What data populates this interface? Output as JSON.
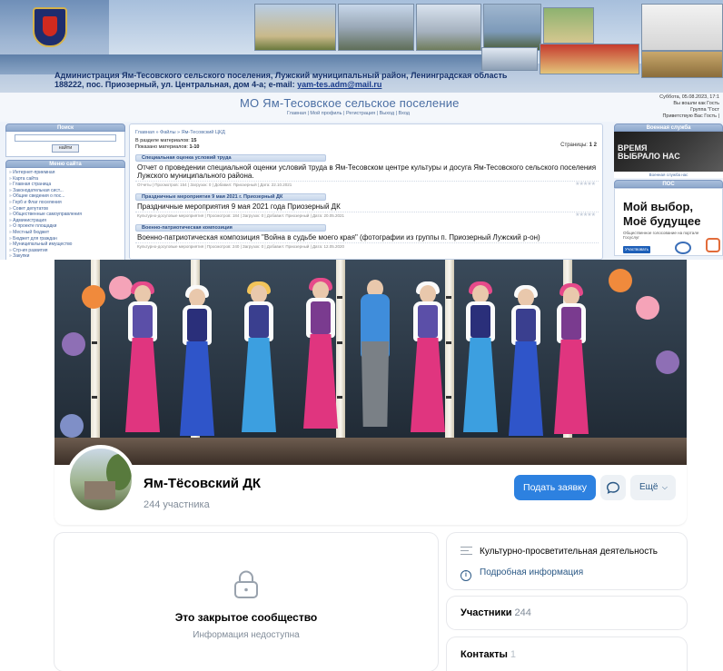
{
  "site": {
    "address_line1": "Администрация Ям-Тесовского сельского поселения, Лужский муниципальный район, Ленинградская область",
    "address_line2": "188222, пос. Приозерный, ул. Центральная, дом 4-а; e-mail: ",
    "email": "yam-tes.adm@mail.ru",
    "title": "МО Ям-Тесовское сельское поселение",
    "top_links": "Главная | Мой профиль | Регистрация | Выход | Вход",
    "user_info": [
      "Суббота, 05.08.2023, 17:1",
      "Вы вошли как Гость",
      "Группа \"Гост",
      "Приветствую Вас Гость |"
    ],
    "search_header": "Поиск",
    "search_button": "найти",
    "menu_header": "Меню сайта",
    "menu_items": [
      "Интернет-приемная",
      "Карта сайта",
      "Главная страница",
      "Законодательная сист...",
      "Общие сведения о пос...",
      "Герб и Флаг поселения",
      "Совет депутатов",
      "Общественные самоуправления",
      "Администрация",
      "О проекте площадки",
      "Местный бюджет",
      "Бюджет для граждан",
      "Муниципальный имущество",
      "Стр-ия развития",
      "Закупки"
    ],
    "breadcrumb": "Главная » Файлы » Ям-Тесовский ЦКД",
    "stat_materials_label": "В разделе материалов: ",
    "stat_materials_value": "15",
    "stat_shown_label": "Показано материалов: ",
    "stat_shown_value": "1-10",
    "pages_label": "Страницы: ",
    "pages_value": "1 2",
    "articles": [
      {
        "category": "Специальная оценка условий труда",
        "title": "Отчет о проведении специальной оценки условий труда в Ям-Тесовском центре культуры и досуга Ям-Тесовского сельского поселения Лужского муниципального района.",
        "meta": "Отчеты | Просмотров: 154 | Загрузок: 0 | Добавил: Приозерный | Дата: 22.10.2021"
      },
      {
        "category": "Праздничные мероприятия 9 мая 2021 г. Приозерный ДК",
        "title": "Праздничные мероприятия 9 мая 2021 года Приозерный ДК",
        "meta": "Культурно-досуговые мероприятия | Просмотров: 184 | Загрузок: 0 | Добавил: Приозерный | Дата: 20.05.2021"
      },
      {
        "category": "Военно-патриотическая композиция",
        "title": "Военно-патриотическая композиция \"Война в судьбе моего края\" (фотографии из группы п. Приозерный Лужский р-он)",
        "meta": "Культурно-досуговые мероприятия | Просмотров: 240 | Загрузок: 0 | Добавил: Приозерный | Дата: 12.05.2020"
      }
    ],
    "right_header1": "Военная служба",
    "banner_dark_text": "ВРЕМЯ\nВЫБРАЛО НАС",
    "banner_dark_link": "Военная служба нас",
    "right_header2": "ПОС",
    "banner_white_line1": "Мой выбор,",
    "banner_white_line2": "Моё будущее",
    "banner_white_sub": "Общественное голосование на портале Госуслуг",
    "banner_white_btn": "Участвовать"
  },
  "community": {
    "name": "Ям-Тёсовский ДК",
    "members": "244 участника",
    "apply_button": "Подать заявку",
    "more_button": "Ещё",
    "closed_title": "Это закрытое сообщество",
    "closed_sub": "Информация недоступна",
    "category": "Культурно-просветительная деятельность",
    "details_link": "Подробная информация",
    "members_label": "Участники",
    "members_count": "244",
    "contacts_label": "Контакты",
    "contacts_count": "1"
  },
  "colors": {
    "vk_blue": "#2d81e0",
    "vk_link": "#2a5885",
    "site_blue": "#4a6ea3"
  },
  "icons": [
    "coat-of-arms-icon",
    "lock-icon",
    "message-icon",
    "chevron-down-icon",
    "list-icon",
    "info-icon"
  ]
}
